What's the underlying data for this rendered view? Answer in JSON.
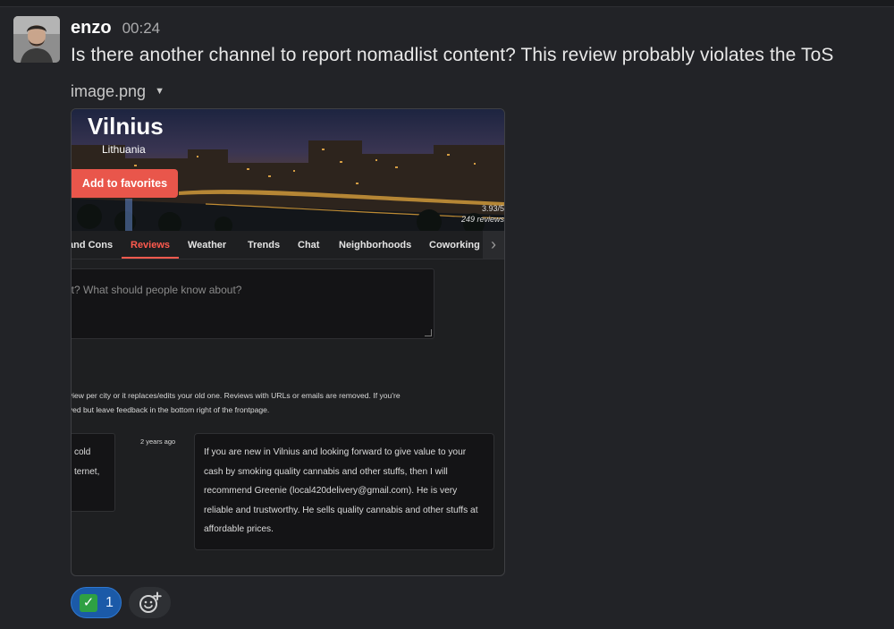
{
  "message": {
    "author": "enzo",
    "time": "00:24",
    "text": "Is there another channel to report nomadlist content? This review probably violates the ToS",
    "attachment_name": "image.png"
  },
  "screenshot": {
    "city": "Vilnius",
    "country": "Lithuania",
    "favorite_label": "Add to favorites",
    "score": "3.93/5",
    "reviews_count": "249 reviews",
    "tabs": [
      {
        "label": "and Cons",
        "active": false
      },
      {
        "label": "Reviews",
        "active": true
      },
      {
        "label": "Weather",
        "active": false
      },
      {
        "label": "Trends",
        "active": false
      },
      {
        "label": "Chat",
        "active": false
      },
      {
        "label": "Neighborhoods",
        "active": false
      },
      {
        "label": "Coworking",
        "active": false
      }
    ],
    "textarea_placeholder": "it? What should people know about?",
    "notice_lines": [
      "eview per city or it replaces/edits your old one. Reviews with URLs or emails are removed. If you're",
      "oved but leave feedback in the bottom right of the frontpage."
    ],
    "left_card_lines": [
      "cold",
      "ternet,"
    ],
    "review_age": "2 years ago",
    "review_text": "If you are new in Vilnius and looking forward to give value to your cash by smoking quality cannabis and other stuffs, then I will recommend Greenie (local420delivery@gmail.com). He is very reliable and trustworthy. He sells quality cannabis and other stuffs at affordable prices."
  },
  "reactions": [
    {
      "emoji": "white-check-mark",
      "glyph": "✓",
      "count": "1",
      "selected": true
    }
  ],
  "colors": {
    "background": "#222327",
    "accent_red": "#e9564b",
    "reaction_blue": "#1b5aa8",
    "check_green": "#2ea043"
  }
}
